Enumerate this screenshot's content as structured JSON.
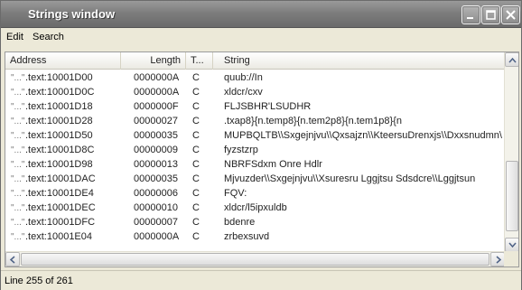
{
  "window": {
    "title": "Strings window"
  },
  "menu": {
    "items": [
      "Edit",
      "Search"
    ]
  },
  "columns": [
    "Address",
    "Length",
    "T...",
    "String"
  ],
  "rows": [
    {
      "address": ".text:10001D00",
      "length": "0000000A",
      "type": "C",
      "string": "quub://In"
    },
    {
      "address": ".text:10001D0C",
      "length": "0000000A",
      "type": "C",
      "string": "xldcr/cxv"
    },
    {
      "address": ".text:10001D18",
      "length": "0000000F",
      "type": "C",
      "string": "FLJSBHR'LSUDHR"
    },
    {
      "address": ".text:10001D28",
      "length": "00000027",
      "type": "C",
      "string": ".txap8}{n.temp8}{n.tem2p8}{n.tem1p8}{n"
    },
    {
      "address": ".text:10001D50",
      "length": "00000035",
      "type": "C",
      "string": "MUPBQLTB\\\\Sxgejnjvu\\\\Qxsajzn\\\\KteersuDrenxjs\\\\Dxxsnudmn\\"
    },
    {
      "address": ".text:10001D8C",
      "length": "00000009",
      "type": "C",
      "string": "fyzstzrp"
    },
    {
      "address": ".text:10001D98",
      "length": "00000013",
      "type": "C",
      "string": "NBRFSdxm Onre Hdlr"
    },
    {
      "address": ".text:10001DAC",
      "length": "00000035",
      "type": "C",
      "string": "Mjvuzder\\\\Sxgejnjvu\\\\Xsuresru Lggjtsu Sdsdcre\\\\Lggjtsun"
    },
    {
      "address": ".text:10001DE4",
      "length": "00000006",
      "type": "C",
      "string": "FQV:"
    },
    {
      "address": ".text:10001DEC",
      "length": "00000010",
      "type": "C",
      "string": "xldcr/l5ipxuldb"
    },
    {
      "address": ".text:10001DFC",
      "length": "00000007",
      "type": "C",
      "string": "bdenre"
    },
    {
      "address": ".text:10001E04",
      "length": "0000000A",
      "type": "C",
      "string": "zrbexsuvd"
    }
  ],
  "status": {
    "text": "Line 255 of 261"
  }
}
